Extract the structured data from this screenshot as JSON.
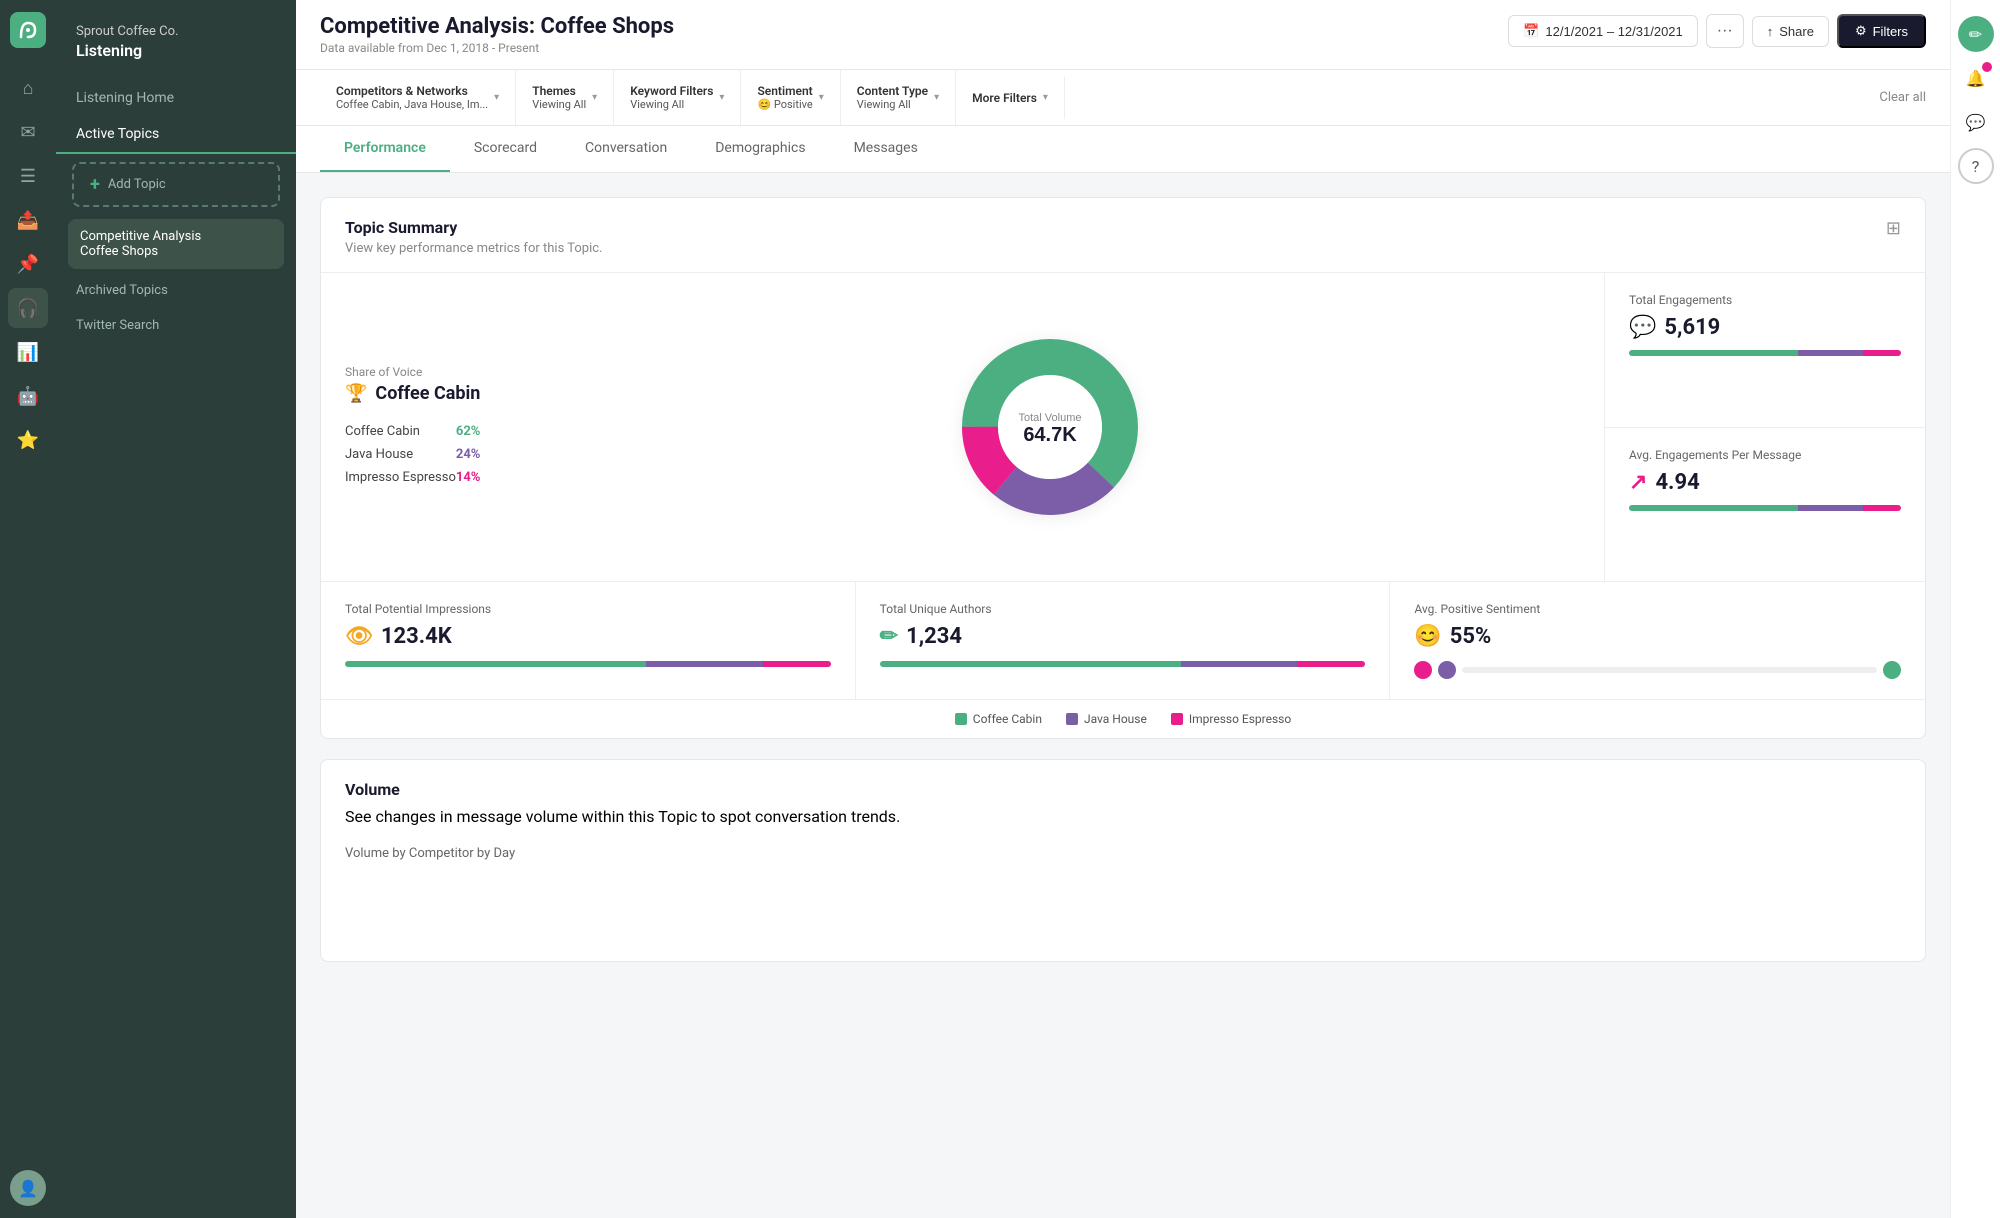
{
  "app": {
    "company": "Sprout Coffee Co.",
    "section": "Listening"
  },
  "sidebar": {
    "nav": [
      {
        "label": "Listening Home",
        "icon": "🏠",
        "active": false
      },
      {
        "label": "Active Topics",
        "icon": "📋",
        "active": true
      }
    ],
    "add_topic_label": "+ Add Topic",
    "topics": [
      {
        "label": "Competitive Analysis\nCoffee Shops",
        "selected": true
      }
    ],
    "links": [
      {
        "label": "Archived Topics"
      },
      {
        "label": "Twitter Search"
      }
    ]
  },
  "topbar": {
    "title": "Competitive Analysis: Coffee Shops",
    "subtitle": "Data available from Dec 1, 2018 - Present",
    "date_range": "12/1/2021 – 12/31/2021",
    "share_label": "Share",
    "filters_label": "Filters"
  },
  "filters": [
    {
      "label": "Competitors & Networks",
      "value": "Coffee Cabin, Java House, Im..."
    },
    {
      "label": "Themes",
      "value": "Viewing All"
    },
    {
      "label": "Keyword Filters",
      "value": "Viewing All"
    },
    {
      "label": "Sentiment",
      "value": "😊 Positive"
    },
    {
      "label": "Content Type",
      "value": "Viewing All"
    },
    {
      "label": "More Filters",
      "value": ""
    }
  ],
  "clear_all": "Clear all",
  "tabs": [
    {
      "label": "Performance",
      "active": true
    },
    {
      "label": "Scorecard",
      "active": false
    },
    {
      "label": "Conversation",
      "active": false
    },
    {
      "label": "Demographics",
      "active": false
    },
    {
      "label": "Messages",
      "active": false
    }
  ],
  "topic_summary": {
    "title": "Topic Summary",
    "subtitle": "View key performance metrics for this Topic.",
    "share_of_voice": {
      "label": "Share of Voice",
      "winner": "Coffee Cabin",
      "trophy_icon": "🏆",
      "competitors": [
        {
          "name": "Coffee Cabin",
          "pct": "62%",
          "color": "green"
        },
        {
          "name": "Java House",
          "pct": "24%",
          "color": "purple"
        },
        {
          "name": "Impresso Espresso",
          "pct": "14%",
          "color": "pink"
        }
      ]
    },
    "donut": {
      "center_label": "Total Volume",
      "center_value": "64.7K",
      "segments": [
        {
          "name": "Coffee Cabin",
          "pct": 62,
          "color": "#4caf82"
        },
        {
          "name": "Java House",
          "pct": 24,
          "color": "#7b5ea7"
        },
        {
          "name": "Impresso Espresso",
          "pct": 14,
          "color": "#e91e8c"
        }
      ]
    },
    "metrics": [
      {
        "label": "Total Engagements",
        "value": "5,619",
        "icon": "💬",
        "bar": [
          62,
          24,
          14
        ]
      },
      {
        "label": "Avg. Engagements Per Message",
        "value": "4.94",
        "icon": "↗",
        "bar": [
          62,
          24,
          14
        ]
      }
    ],
    "bottom_stats": [
      {
        "label": "Total Potential Impressions",
        "value": "123.4K",
        "icon": "👁",
        "icon_color": "#f5a623",
        "bar": [
          62,
          24,
          14
        ]
      },
      {
        "label": "Total Unique Authors",
        "value": "1,234",
        "icon": "✏",
        "icon_color": "#4caf82",
        "bar": [
          62,
          24,
          14
        ]
      },
      {
        "label": "Avg. Positive Sentiment",
        "value": "55%",
        "icon": "😊",
        "icon_color": "#f5a623",
        "bar_special": true
      }
    ],
    "legend": [
      {
        "label": "Coffee Cabin",
        "color": "#4caf82"
      },
      {
        "label": "Java House",
        "color": "#7b5ea7"
      },
      {
        "label": "Impresso Espresso",
        "color": "#e91e8c"
      }
    ]
  },
  "volume": {
    "title": "Volume",
    "subtitle": "See changes in message volume within this Topic to spot conversation trends.",
    "by_label": "Volume by Competitor by Day"
  },
  "right_rail": {
    "icons": [
      {
        "name": "edit-icon",
        "symbol": "✏",
        "highlight": true,
        "badge": false
      },
      {
        "name": "notification-icon",
        "symbol": "🔔",
        "highlight": false,
        "badge": true
      },
      {
        "name": "comment-icon",
        "symbol": "💬",
        "highlight": false,
        "badge": false
      },
      {
        "name": "help-icon",
        "symbol": "?",
        "highlight": false,
        "badge": false
      }
    ]
  }
}
